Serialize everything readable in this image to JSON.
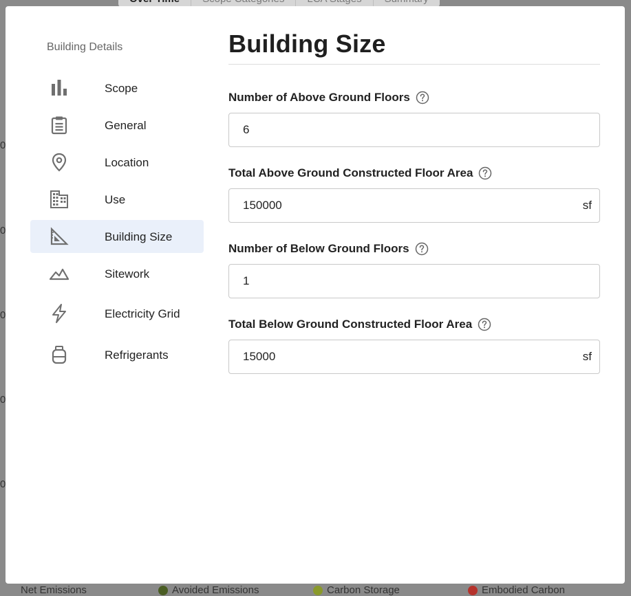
{
  "background": {
    "tabs": [
      "Over Time",
      "Scope Categories",
      "LCA Stages",
      "Summary"
    ],
    "axis_ticks": [
      "0",
      "0",
      "0",
      "0",
      "0"
    ],
    "legend": [
      {
        "label": "Net Emissions",
        "color": ""
      },
      {
        "label": "Avoided Emissions",
        "color": "#4a5d23"
      },
      {
        "label": "Carbon Storage",
        "color": "#8a9a2b"
      },
      {
        "label": "Embodied Carbon",
        "color": "#b5322b"
      }
    ]
  },
  "sidebar": {
    "heading": "Building Details",
    "items": [
      {
        "label": "Scope",
        "icon": "bar-chart-icon"
      },
      {
        "label": "General",
        "icon": "clipboard-icon"
      },
      {
        "label": "Location",
        "icon": "map-pin-icon"
      },
      {
        "label": "Use",
        "icon": "building-icon"
      },
      {
        "label": "Building Size",
        "icon": "triangle-ruler-icon",
        "active": true
      },
      {
        "label": "Sitework",
        "icon": "terrain-icon"
      },
      {
        "label": "Electricity Grid",
        "icon": "lightning-icon"
      },
      {
        "label": "Refrigerants",
        "icon": "canister-icon"
      }
    ]
  },
  "main": {
    "title": "Building Size",
    "fields": [
      {
        "label": "Number of Above Ground Floors",
        "value": "6",
        "unit": ""
      },
      {
        "label": "Total Above Ground Constructed Floor Area",
        "value": "150000",
        "unit": "sf"
      },
      {
        "label": "Number of Below Ground Floors",
        "value": "1",
        "unit": ""
      },
      {
        "label": "Total Below Ground Constructed Floor Area",
        "value": "15000",
        "unit": "sf"
      }
    ]
  },
  "colors": {
    "accent_active_bg": "#eaf0fa",
    "icon_gray": "#6f6f6f"
  }
}
